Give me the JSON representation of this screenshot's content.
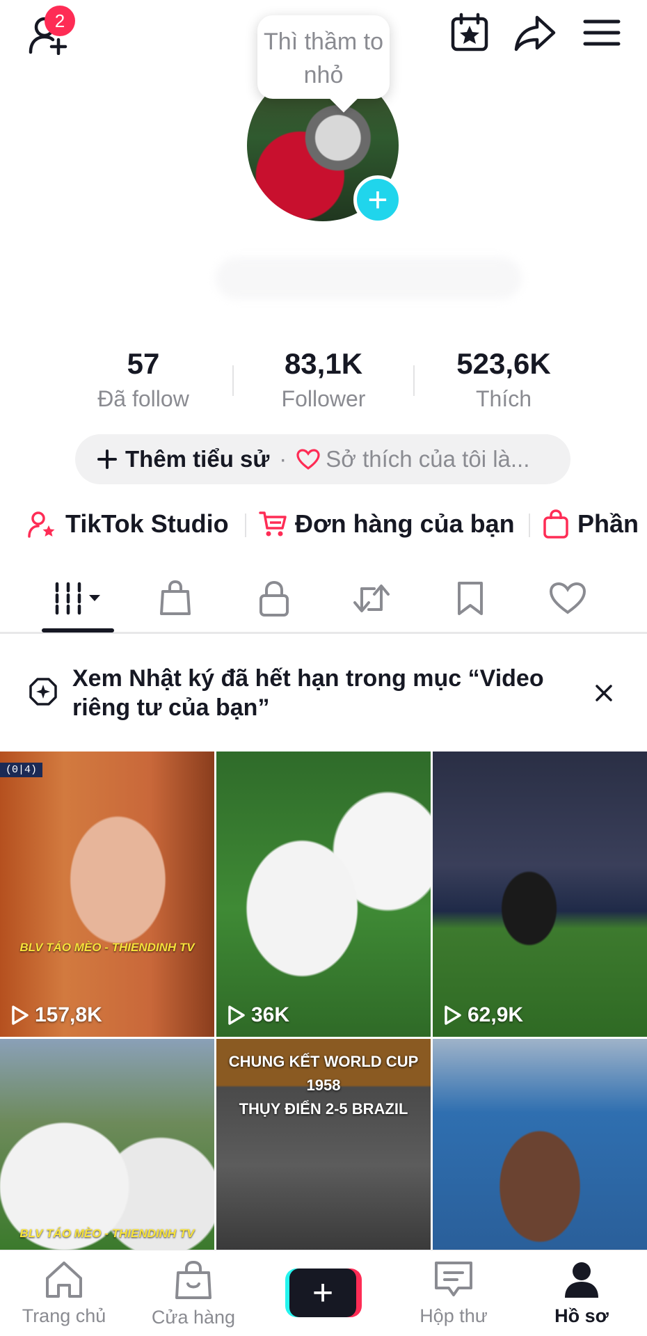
{
  "header": {
    "friend_badge": "2",
    "tooltip": "Thì thầm to nhỏ"
  },
  "stats": [
    {
      "value": "57",
      "label": "Đã follow"
    },
    {
      "value": "83,1K",
      "label": "Follower"
    },
    {
      "value": "523,6K",
      "label": "Thích"
    }
  ],
  "bio": {
    "add_label": "Thêm tiểu sử",
    "separator": "·",
    "interests": "Sở thích của tôi là..."
  },
  "links": [
    {
      "label": "TikTok Studio",
      "icon": "person-star-icon"
    },
    {
      "label": "Đơn hàng của bạn",
      "icon": "cart-icon"
    },
    {
      "label": "Phần",
      "icon": "bag-icon"
    }
  ],
  "tabs": [
    "videos-grid-icon",
    "shop-bag-icon",
    "lock-icon",
    "repost-icon",
    "bookmark-icon",
    "heart-icon"
  ],
  "notice": {
    "text": "Xem Nhật ký đã hết hạn trong mục “Video riêng tư của bạn”"
  },
  "videos": [
    {
      "views": "157,8K",
      "watermark": "BLV TÁO MÈO - THIENDINH TV",
      "score_tag": "(0|4)"
    },
    {
      "views": "36K"
    },
    {
      "views": "62,9K"
    },
    {
      "views": "",
      "watermark": "BLV TÁO MÈO - THIENDINH TV"
    },
    {
      "views": "",
      "caption_line1": "CHUNG KẾT WORLD CUP 1958",
      "caption_line2": "THỤY ĐIỂN 2-5 BRAZIL"
    },
    {
      "views": ""
    }
  ],
  "bottom_nav": [
    {
      "label": "Trang chủ"
    },
    {
      "label": "Cửa hàng"
    },
    {
      "label": "Hộp thư"
    },
    {
      "label": "Hồ sơ"
    }
  ],
  "colors": {
    "accent": "#fe2c55",
    "cyan": "#20d5ec",
    "text": "#161823",
    "muted": "#8a8b91"
  }
}
